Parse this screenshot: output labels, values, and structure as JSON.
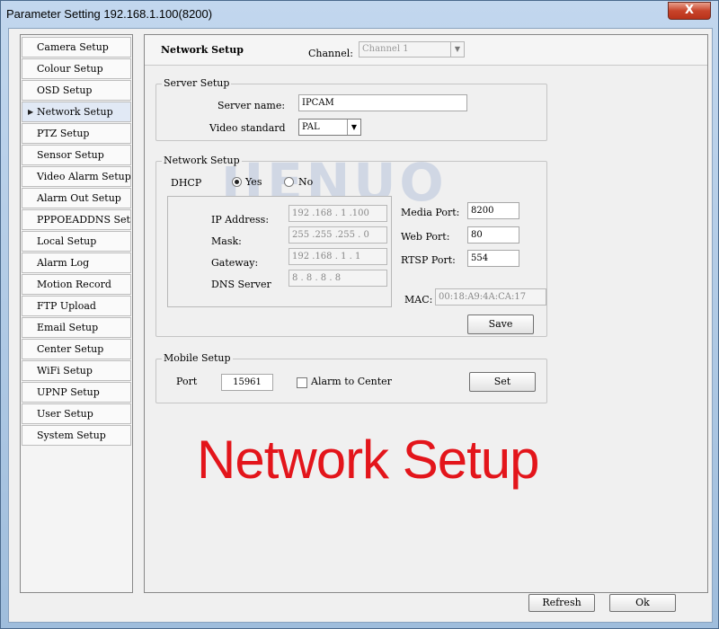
{
  "window": {
    "title": "Parameter Setting 192.168.1.100(8200)",
    "close_glyph": "X"
  },
  "sidebar": {
    "items": [
      {
        "label": "Camera Setup"
      },
      {
        "label": "Colour Setup"
      },
      {
        "label": "OSD Setup"
      },
      {
        "label": "Network Setup",
        "active": true
      },
      {
        "label": "PTZ Setup"
      },
      {
        "label": "Sensor Setup"
      },
      {
        "label": "Video Alarm Setup"
      },
      {
        "label": "Alarm Out Setup"
      },
      {
        "label": "PPPOEADDNS Setup"
      },
      {
        "label": "Local Setup"
      },
      {
        "label": "Alarm Log"
      },
      {
        "label": "Motion Record"
      },
      {
        "label": "FTP Upload"
      },
      {
        "label": "Email Setup"
      },
      {
        "label": "Center Setup"
      },
      {
        "label": "WiFi Setup"
      },
      {
        "label": "UPNP Setup"
      },
      {
        "label": "User Setup"
      },
      {
        "label": "System Setup"
      }
    ]
  },
  "header": {
    "title": "Network Setup",
    "channel_label": "Channel:",
    "channel_value": "Channel 1"
  },
  "server_setup": {
    "title": "Server Setup",
    "server_name_label": "Server name:",
    "server_name_value": "IPCAM",
    "video_standard_label": "Video standard",
    "video_standard_value": "PAL"
  },
  "network_setup": {
    "title": "Network Setup",
    "dhcp_label": "DHCP",
    "dhcp_yes": "Yes",
    "dhcp_no": "No",
    "ip_label": "IP Address:",
    "ip_value": "192 .168 . 1  .100",
    "mask_label": "Mask:",
    "mask_value": "255 .255 .255 . 0",
    "gateway_label": "Gateway:",
    "gateway_value": "192 .168 . 1  . 1",
    "dns_label": "DNS Server",
    "dns_value": "8  . 8  . 8  . 8",
    "media_port_label": "Media Port:",
    "media_port_value": "8200",
    "web_port_label": "Web Port:",
    "web_port_value": "80",
    "rtsp_port_label": "RTSP Port:",
    "rtsp_port_value": "554",
    "mac_label": "MAC:",
    "mac_value": "00:18:A9:4A:CA:17",
    "save_label": "Save"
  },
  "mobile_setup": {
    "title": "Mobile Setup",
    "port_label": "Port",
    "port_value": "15961",
    "alarm_label": "Alarm to Center",
    "set_label": "Set"
  },
  "watermark": "JIENUO",
  "overlay_caption": "Network Setup",
  "footer": {
    "refresh_label": "Refresh",
    "ok_label": "Ok"
  },
  "colors": {
    "caption_red": "#e3151b",
    "active_nav": "#e1e9f5"
  }
}
